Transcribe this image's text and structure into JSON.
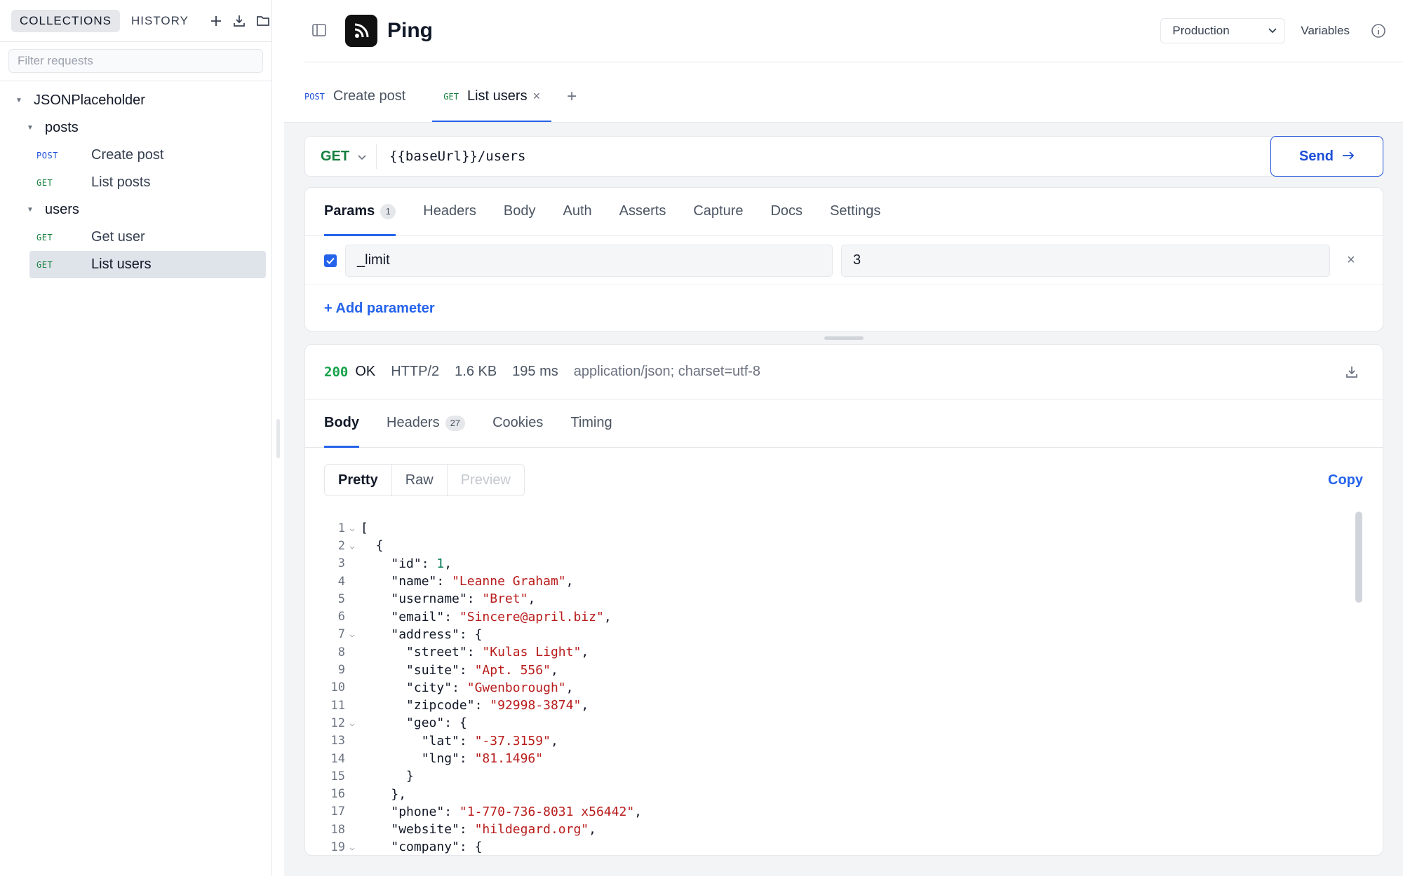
{
  "sidebar": {
    "tabs": [
      "COLLECTIONS",
      "HISTORY"
    ],
    "actions": [
      "add-icon",
      "import-icon",
      "folder-icon"
    ],
    "filter_placeholder": "Filter requests",
    "collection": {
      "name": "JSONPlaceholder",
      "folders": [
        {
          "name": "posts",
          "requests": [
            {
              "method": "POST",
              "name": "Create post"
            },
            {
              "method": "GET",
              "name": "List posts"
            }
          ]
        },
        {
          "name": "users",
          "requests": [
            {
              "method": "GET",
              "name": "Get user"
            },
            {
              "method": "GET",
              "name": "List users"
            }
          ]
        }
      ]
    }
  },
  "header": {
    "app_title": "Ping",
    "environment": "Production",
    "variables_label": "Variables"
  },
  "tabs": [
    {
      "method": "POST",
      "name": "Create post"
    },
    {
      "method": "GET",
      "name": "List users"
    }
  ],
  "request": {
    "method": "GET",
    "url": "{{baseUrl}}/users",
    "send_label": "Send",
    "subtabs": [
      "Params",
      "Headers",
      "Body",
      "Auth",
      "Asserts",
      "Capture",
      "Docs",
      "Settings"
    ],
    "params_count": "1",
    "params": [
      {
        "enabled": true,
        "key": "_limit",
        "value": "3"
      }
    ],
    "add_param_label": "+ Add parameter"
  },
  "response": {
    "status_code": "200",
    "status_text": "OK",
    "protocol": "HTTP/2",
    "size": "1.6 KB",
    "time": "195 ms",
    "content_type": "application/json; charset=utf-8",
    "tabs": [
      "Body",
      "Headers",
      "Cookies",
      "Timing"
    ],
    "headers_count": "27",
    "views": [
      "Pretty",
      "Raw",
      "Preview"
    ],
    "copy_label": "Copy",
    "lines": [
      {
        "n": "1",
        "fold": true,
        "indent": "",
        "key": "",
        "val": "[",
        "type": "p",
        "tail": ""
      },
      {
        "n": "2",
        "fold": true,
        "indent": "  ",
        "key": "",
        "val": "{",
        "type": "p",
        "tail": ""
      },
      {
        "n": "3",
        "fold": false,
        "indent": "    ",
        "key": "\"id\"",
        "val": "1",
        "type": "n",
        "tail": ","
      },
      {
        "n": "4",
        "fold": false,
        "indent": "    ",
        "key": "\"name\"",
        "val": "\"Leanne Graham\"",
        "type": "s",
        "tail": ","
      },
      {
        "n": "5",
        "fold": false,
        "indent": "    ",
        "key": "\"username\"",
        "val": "\"Bret\"",
        "type": "s",
        "tail": ","
      },
      {
        "n": "6",
        "fold": false,
        "indent": "    ",
        "key": "\"email\"",
        "val": "\"Sincere@april.biz\"",
        "type": "s",
        "tail": ","
      },
      {
        "n": "7",
        "fold": true,
        "indent": "    ",
        "key": "\"address\"",
        "val": "{",
        "type": "p",
        "tail": ""
      },
      {
        "n": "8",
        "fold": false,
        "indent": "      ",
        "key": "\"street\"",
        "val": "\"Kulas Light\"",
        "type": "s",
        "tail": ","
      },
      {
        "n": "9",
        "fold": false,
        "indent": "      ",
        "key": "\"suite\"",
        "val": "\"Apt. 556\"",
        "type": "s",
        "tail": ","
      },
      {
        "n": "10",
        "fold": false,
        "indent": "      ",
        "key": "\"city\"",
        "val": "\"Gwenborough\"",
        "type": "s",
        "tail": ","
      },
      {
        "n": "11",
        "fold": false,
        "indent": "      ",
        "key": "\"zipcode\"",
        "val": "\"92998-3874\"",
        "type": "s",
        "tail": ","
      },
      {
        "n": "12",
        "fold": true,
        "indent": "      ",
        "key": "\"geo\"",
        "val": "{",
        "type": "p",
        "tail": ""
      },
      {
        "n": "13",
        "fold": false,
        "indent": "        ",
        "key": "\"lat\"",
        "val": "\"-37.3159\"",
        "type": "s",
        "tail": ","
      },
      {
        "n": "14",
        "fold": false,
        "indent": "        ",
        "key": "\"lng\"",
        "val": "\"81.1496\"",
        "type": "s",
        "tail": ""
      },
      {
        "n": "15",
        "fold": false,
        "indent": "      ",
        "key": "",
        "val": "}",
        "type": "p",
        "tail": ""
      },
      {
        "n": "16",
        "fold": false,
        "indent": "    ",
        "key": "",
        "val": "},",
        "type": "p",
        "tail": ""
      },
      {
        "n": "17",
        "fold": false,
        "indent": "    ",
        "key": "\"phone\"",
        "val": "\"1-770-736-8031 x56442\"",
        "type": "s",
        "tail": ","
      },
      {
        "n": "18",
        "fold": false,
        "indent": "    ",
        "key": "\"website\"",
        "val": "\"hildegard.org\"",
        "type": "s",
        "tail": ","
      },
      {
        "n": "19",
        "fold": true,
        "indent": "    ",
        "key": "\"company\"",
        "val": "{",
        "type": "p",
        "tail": ""
      }
    ]
  },
  "colors": {
    "accent": "#2563eb",
    "get": "#15803d",
    "post": "#1d4ed8",
    "string": "#b91c1c",
    "number": "#047857",
    "status_ok": "#16a34a"
  }
}
